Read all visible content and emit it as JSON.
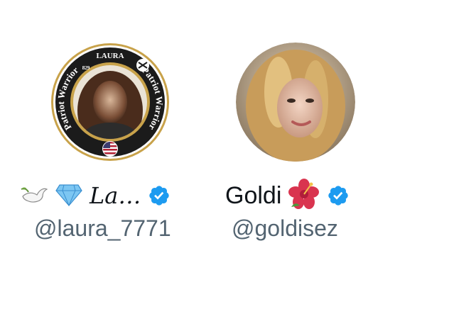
{
  "profiles": [
    {
      "display_name": "La…",
      "handle": "@laura_7771",
      "verified": true,
      "name_emojis": [
        "dove-icon",
        "gem-icon"
      ],
      "avatar": {
        "badge_top_text": "LAURA",
        "badge_number": "829",
        "badge_ring_text": "Patriot Warriors"
      }
    },
    {
      "display_name": "Goldi",
      "handle": "@goldisez",
      "verified": true,
      "name_emojis": [
        "hibiscus-icon"
      ]
    }
  ],
  "colors": {
    "verified_blue": "#1d9bf0",
    "name_text": "#0f1419",
    "handle_text": "#536471",
    "badge_ring": "#1b1b1b",
    "badge_gold": "#c8a24a"
  }
}
